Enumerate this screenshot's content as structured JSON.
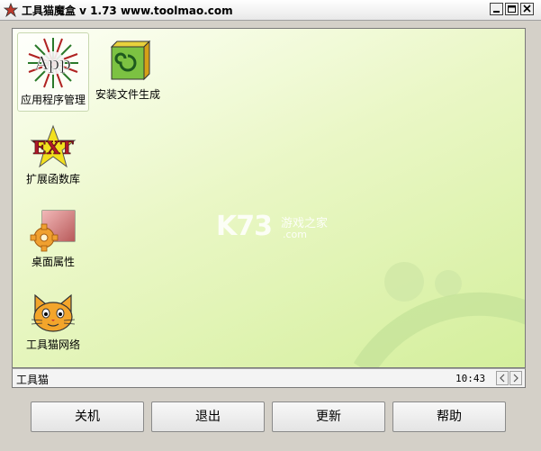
{
  "window": {
    "title": "工具猫魔盒 v 1.73 www.toolmao.com",
    "controls": [
      "minimize",
      "maximize",
      "close"
    ]
  },
  "desktop": {
    "items": [
      {
        "label": "应用程序管理",
        "icon": "app-starburst-icon",
        "icon_text": "App",
        "selected": true
      },
      {
        "label": "安装文件生成",
        "icon": "installer-box-icon"
      },
      {
        "label": "扩展函数库",
        "icon": "ext-star-icon",
        "icon_text": "EXT"
      },
      {
        "label": "桌面属性",
        "icon": "desktop-gear-icon"
      },
      {
        "label": "工具猫网络",
        "icon": "cat-face-icon"
      }
    ],
    "watermark": {
      "main": "K73",
      "sub": "游戏之家",
      "domain": ".com"
    },
    "colors": {
      "background_light": "#fdfff6",
      "background_dark": "#d4ef9c"
    }
  },
  "statusbar": {
    "text": "工具猫",
    "time": "10:43"
  },
  "buttons": {
    "shutdown": "关机",
    "exit": "退出",
    "update": "更新",
    "help": "帮助"
  }
}
